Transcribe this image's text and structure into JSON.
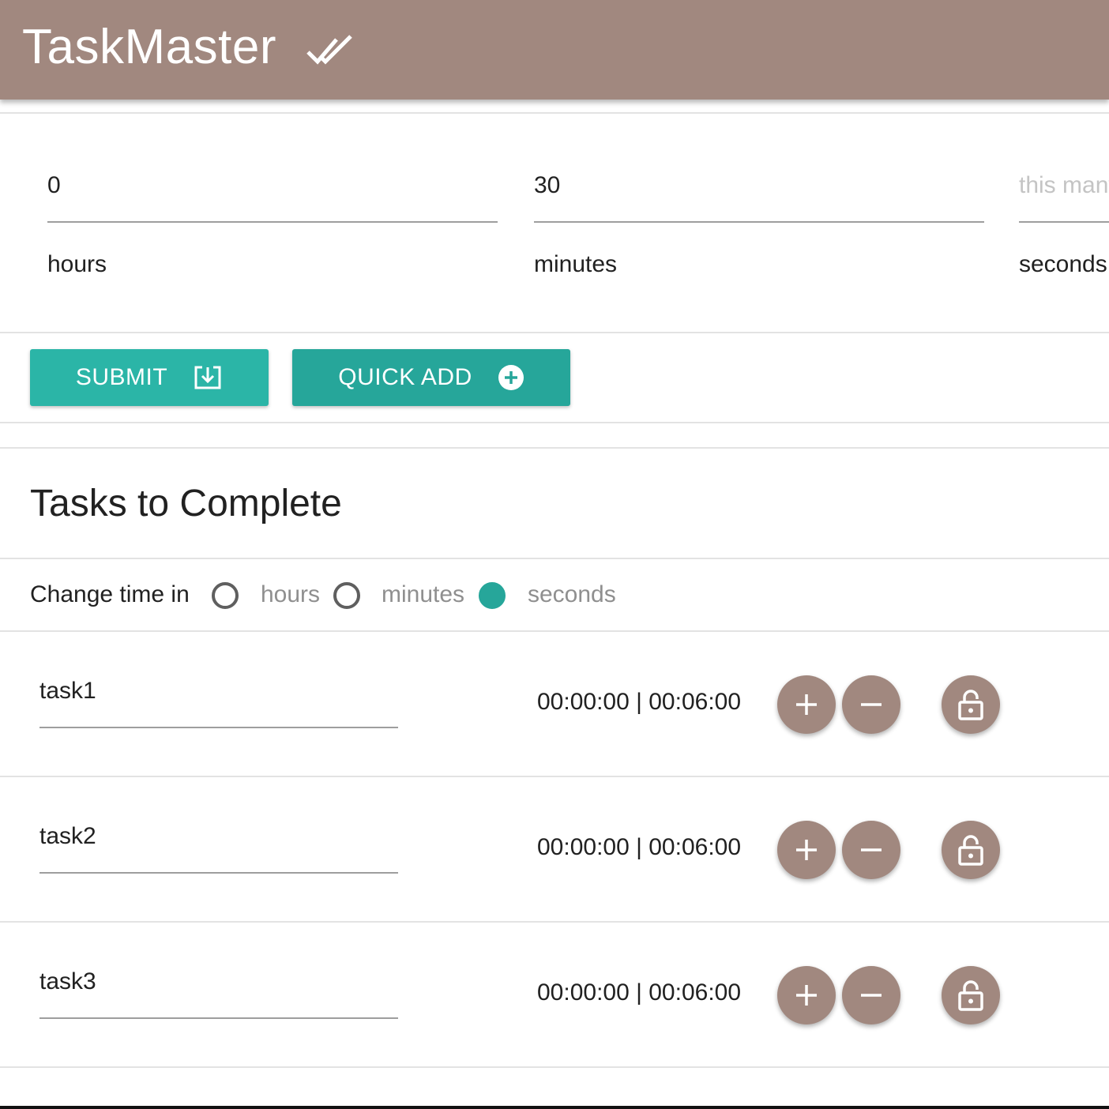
{
  "app": {
    "title": "TaskMaster",
    "title_icon": "double-check-icon",
    "bar_color": "#a1887f"
  },
  "time_inputs": [
    {
      "value": "0",
      "placeholder": "",
      "label": "hours"
    },
    {
      "value": "30",
      "placeholder": "",
      "label": "minutes"
    },
    {
      "value": "",
      "placeholder": "this many",
      "label": "seconds"
    }
  ],
  "buttons": {
    "submit": {
      "label": "SUBMIT",
      "icon": "save-download-icon"
    },
    "quick_add": {
      "label": "QUICK ADD",
      "icon": "add-circle-icon"
    }
  },
  "tasks_section": {
    "title": "Tasks to Complete",
    "change_time": {
      "label": "Change time in",
      "options": [
        {
          "label": "hours",
          "selected": false
        },
        {
          "label": "minutes",
          "selected": false
        },
        {
          "label": "seconds",
          "selected": true
        }
      ]
    },
    "tasks": [
      {
        "name": "task1",
        "time": "00:00:00 | 00:06:00"
      },
      {
        "name": "task2",
        "time": "00:00:00 | 00:06:00"
      },
      {
        "name": "task3",
        "time": "00:00:00 | 00:06:00"
      }
    ]
  },
  "colors": {
    "accent": "#26a69a",
    "submit": "#2bb5a7",
    "fab": "#a1887f"
  }
}
